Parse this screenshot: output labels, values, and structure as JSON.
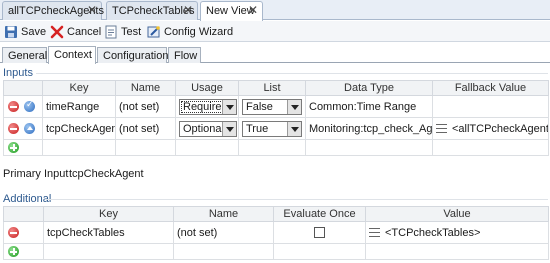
{
  "editor_tabs": [
    {
      "label": "allTCPcheckAgents"
    },
    {
      "label": "TCPcheckTables"
    },
    {
      "label": "New View"
    }
  ],
  "toolbar": {
    "save": "Save",
    "cancel": "Cancel",
    "test": "Test",
    "config_wizard": "Config Wizard"
  },
  "sub_tabs": [
    {
      "label": "General"
    },
    {
      "label": "Context"
    },
    {
      "label": "Configuration"
    },
    {
      "label": "Flow"
    }
  ],
  "inputs": {
    "section_label": "Inputs",
    "columns": [
      "Key",
      "Name",
      "Usage",
      "List",
      "Data Type",
      "Fallback Value"
    ],
    "rows": [
      {
        "key": "timeRange",
        "name": "(not set)",
        "usage": "Required",
        "list": "False",
        "data_type": "Common:Time Range",
        "fallback": ""
      },
      {
        "key": "tcpCheckAgent",
        "name": "(not set)",
        "usage": "Optional",
        "list": "True",
        "data_type": "Monitoring:tcp_check_Agent",
        "fallback": "<allTCPcheckAgents>"
      }
    ]
  },
  "primary_input": {
    "label": "Primary Input",
    "value": "tcpCheckAgent"
  },
  "additional": {
    "section_label": "Additional",
    "columns": [
      "Key",
      "Name",
      "Evaluate Once",
      "Value"
    ],
    "rows": [
      {
        "key": "tcpCheckTables",
        "name": "(not set)",
        "evaluate_once": false,
        "value": "<TCPcheckTables>"
      }
    ]
  },
  "colors": {
    "accent": "#2e5a8f",
    "tab_bg": "#e8eef6"
  }
}
